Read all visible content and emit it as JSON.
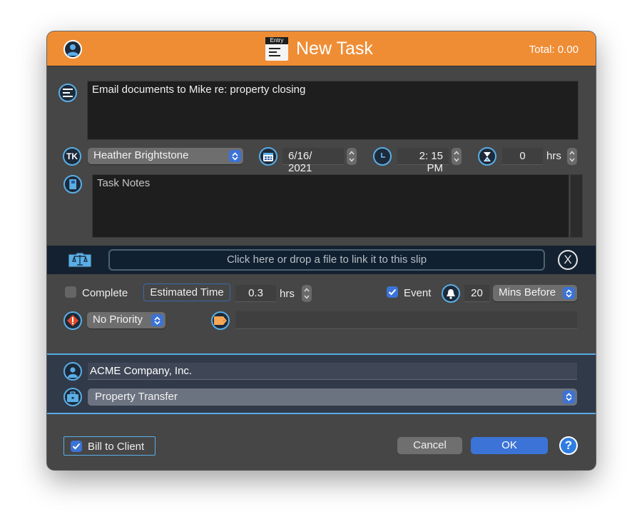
{
  "window": {
    "title": "New Task",
    "title_icon_label": "Entry",
    "total": "Total: 0.00",
    "accent_color": "#ef8d35"
  },
  "task": {
    "description": "Email documents to Mike re: property closing",
    "timekeeper": "Heather Brightstone",
    "date": "6/16/ 2021",
    "time": "2: 15 PM",
    "duration_value": "0",
    "duration_unit": "hrs",
    "notes_placeholder": "Task Notes"
  },
  "file_link": {
    "placeholder": "Click here or drop a file to link it to this slip",
    "close_label": "X"
  },
  "options": {
    "complete_label": "Complete",
    "complete_checked": false,
    "estimated_time_label": "Estimated Time",
    "estimated_time_value": "0.3",
    "estimated_time_unit": "hrs",
    "event_label": "Event",
    "event_checked": true,
    "reminder_value": "20",
    "reminder_unit": "Mins Before",
    "priority": "No Priority",
    "tag_value": ""
  },
  "client": {
    "name": "ACME Company, Inc.",
    "matter": "Property Transfer"
  },
  "footer": {
    "bill_to_client_label": "Bill to Client",
    "bill_to_client_checked": true,
    "cancel_label": "Cancel",
    "ok_label": "OK",
    "help_label": "?"
  }
}
